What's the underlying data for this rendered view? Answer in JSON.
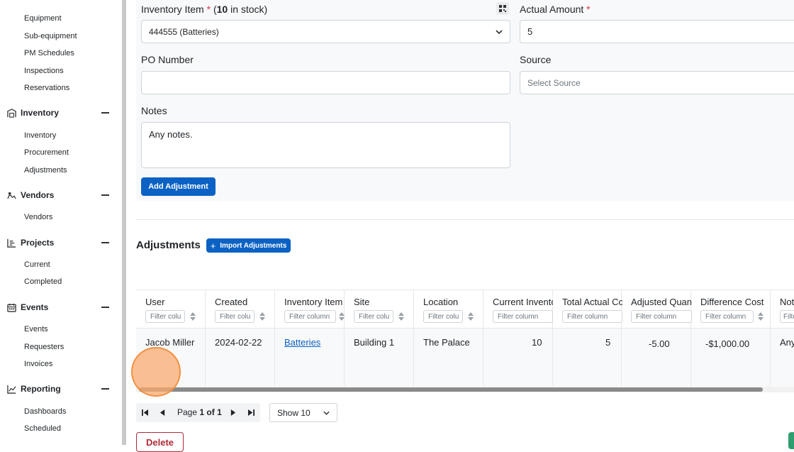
{
  "sidebar": {
    "sections": [
      {
        "title": "",
        "items": [
          "Equipment",
          "Sub-equipment",
          "PM Schedules",
          "Inspections",
          "Reservations"
        ]
      },
      {
        "title": "Inventory",
        "icon": "warehouse-icon",
        "items": [
          "Inventory",
          "Procurement",
          "Adjustments"
        ]
      },
      {
        "title": "Vendors",
        "icon": "vendor-icon",
        "items": [
          "Vendors"
        ]
      },
      {
        "title": "Projects",
        "icon": "projects-chart-icon",
        "items": [
          "Current",
          "Completed"
        ]
      },
      {
        "title": "Events",
        "icon": "calendar-icon",
        "items": [
          "Events",
          "Requesters",
          "Invoices"
        ]
      },
      {
        "title": "Reporting",
        "icon": "line-chart-icon",
        "items": [
          "Dashboards",
          "Scheduled"
        ]
      }
    ]
  },
  "form": {
    "inventory_item_label": "Inventory Item",
    "inventory_stock_prefix": "(",
    "inventory_stock_count": "10",
    "inventory_stock_suffix": " in stock)",
    "required_mark": "*",
    "inventory_item_value": "444555 (Batteries)",
    "actual_amount_label": "Actual Amount",
    "actual_amount_value": "5",
    "po_number_label": "PO Number",
    "po_number_value": "",
    "source_label": "Source",
    "source_placeholder": "Select Source",
    "notes_label": "Notes",
    "notes_value": "Any notes.",
    "add_button": "Add Adjustment"
  },
  "adjustments": {
    "title": "Adjustments",
    "import_button": "Import Adjustments",
    "columns": [
      {
        "label": "User",
        "filter": "Filter colu"
      },
      {
        "label": "Created",
        "filter": "Filter colu"
      },
      {
        "label": "Inventory Item",
        "filter": "Filter column"
      },
      {
        "label": "Site",
        "filter": "Filter colu"
      },
      {
        "label": "Location",
        "filter": "Filter colu"
      },
      {
        "label": "Current Inventory",
        "filter": "Filter column"
      },
      {
        "label": "Total Actual Count",
        "filter": "Filter column"
      },
      {
        "label": "Adjusted Quantity",
        "filter": "Filter column"
      },
      {
        "label": "Difference Cost",
        "filter": "Filter column"
      },
      {
        "label": "Notes",
        "filter": "Filter"
      }
    ],
    "rows": [
      {
        "user": "Jacob Miller",
        "created": "2024-02-22",
        "item": "Batteries",
        "site": "Building 1",
        "location": "The Palace",
        "current": "10",
        "total": "5",
        "adjusted": "-5.00",
        "diff": "-$1,000.00",
        "notes": "Any"
      }
    ]
  },
  "pagination": {
    "page_word": "Page",
    "page_current": "1",
    "of_word": "of",
    "page_total": "1",
    "show_value": "Show 10"
  },
  "delete_button": "Delete"
}
